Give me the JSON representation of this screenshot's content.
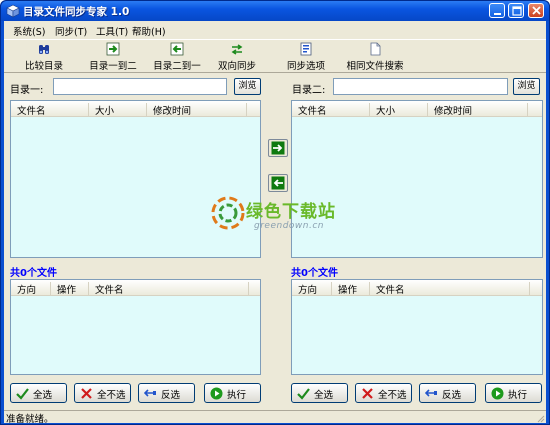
{
  "window": {
    "title": "目录文件同步专家 1.0"
  },
  "menu": [
    "系统(S)",
    "同步(T)",
    "工具(T)",
    "帮助(H)"
  ],
  "toolbar": {
    "compare": "比较目录",
    "dir1_to_2": "目录一到二",
    "dir2_to_1": "目录二到一",
    "two_way": "双向同步",
    "sync_options": "同步选项",
    "same_file_search": "相同文件搜索"
  },
  "left": {
    "dir_label": "目录一:",
    "dir_value": "",
    "browse": "浏览",
    "file_columns": [
      "文件名",
      "大小",
      "修改时间"
    ],
    "file_count": "共0个文件",
    "op_columns": [
      "方向",
      "操作",
      "文件名"
    ]
  },
  "right": {
    "dir_label": "目录二:",
    "dir_value": "",
    "browse": "浏览",
    "file_columns": [
      "文件名",
      "大小",
      "修改时间"
    ],
    "file_count": "共0个文件",
    "op_columns": [
      "方向",
      "操作",
      "文件名"
    ]
  },
  "actions": {
    "select_all": "全选",
    "select_none": "全不选",
    "invert": "反选",
    "execute": "执行"
  },
  "watermark": {
    "brand": "绿色下载站",
    "url": "greendown.cn"
  },
  "status": "准备就绪。",
  "colors": {
    "list_bg": "#e0fbfb",
    "title_blue": "#0a55e0",
    "count_blue": "#0000ff",
    "face": "#ece9d8"
  }
}
